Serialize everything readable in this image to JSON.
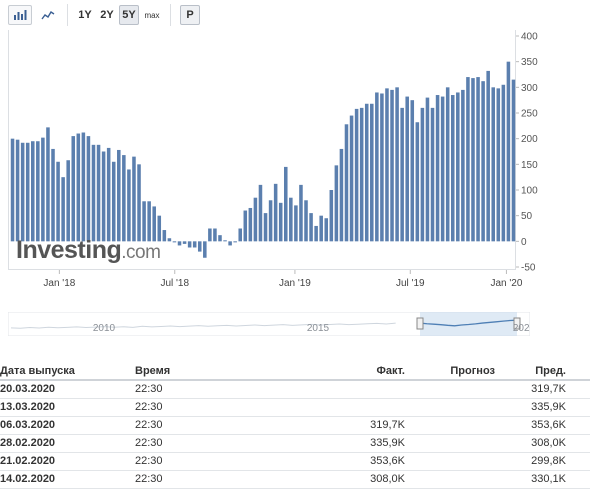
{
  "toolbar": {
    "bar_chart_icon": "bar-chart-icon",
    "line_chart_icon": "line-chart-icon",
    "range_1y": "1Y",
    "range_2y": "2Y",
    "range_5y": "5Y",
    "range_max": "max",
    "print_label": "P",
    "active_range": "5Y"
  },
  "watermark": {
    "brand": "Investing",
    "suffix": ".com"
  },
  "colors": {
    "bar": "#5b7fae",
    "bar_edge": "#4a6d9c",
    "navigator_fill": "#c9dcef",
    "navigator_line": "#4e7fb5"
  },
  "chart_data": {
    "type": "bar",
    "x_ticks": [
      "Jan '18",
      "Jul '18",
      "Jan '19",
      "Jul '19",
      "Jan '20"
    ],
    "y_ticks": [
      400,
      350,
      300,
      250,
      200,
      150,
      100,
      50,
      0,
      -50
    ],
    "ylim": [
      -50,
      400
    ],
    "values": [
      200,
      198,
      192,
      192,
      195,
      195,
      202,
      222,
      180,
      155,
      125,
      158,
      205,
      210,
      212,
      205,
      188,
      188,
      175,
      182,
      155,
      178,
      168,
      140,
      165,
      150,
      78,
      78,
      68,
      50,
      22,
      6,
      -2,
      -8,
      -5,
      -12,
      -12,
      -20,
      -32,
      25,
      25,
      12,
      2,
      -8,
      -2,
      25,
      60,
      65,
      85,
      110,
      55,
      80,
      112,
      75,
      145,
      85,
      70,
      110,
      80,
      55,
      30,
      50,
      45,
      100,
      148,
      180,
      228,
      245,
      258,
      260,
      268,
      268,
      290,
      288,
      298,
      295,
      300,
      260,
      282,
      275,
      232,
      260,
      280,
      260,
      285,
      282,
      300,
      285,
      290,
      295,
      320,
      318,
      320,
      312,
      332,
      300,
      298,
      305,
      350,
      315
    ]
  },
  "navigator": {
    "year_labels": [
      "2010",
      "2015",
      "2020"
    ],
    "series": [
      0.32,
      0.3,
      0.34,
      0.31,
      0.36,
      0.33,
      0.35,
      0.38,
      0.34,
      0.37,
      0.4,
      0.36,
      0.39,
      0.35,
      0.42,
      0.38,
      0.41,
      0.44,
      0.4,
      0.43,
      0.46,
      0.42,
      0.45,
      0.48,
      0.44,
      0.47,
      0.5,
      0.46,
      0.49,
      0.52,
      0.48,
      0.51,
      0.54,
      0.5,
      0.53,
      0.56,
      0.52,
      0.55,
      0.58,
      0.6,
      0.56,
      0.62,
      0.58,
      0.55,
      0.52,
      0.48,
      0.45,
      0.5,
      0.53,
      0.57,
      0.62,
      0.66,
      0.7,
      0.74,
      0.78,
      0.8
    ]
  },
  "table": {
    "headers": {
      "date": "Дата выпуска",
      "time": "Время",
      "actual": "Факт.",
      "forecast": "Прогноз",
      "previous": "Пред."
    },
    "rows": [
      {
        "date": "20.03.2020",
        "time": "22:30",
        "actual": "",
        "forecast": "",
        "previous": "319,7K"
      },
      {
        "date": "13.03.2020",
        "time": "22:30",
        "actual": "",
        "forecast": "",
        "previous": "335,9K"
      },
      {
        "date": "06.03.2020",
        "time": "22:30",
        "actual": "319,7K",
        "forecast": "",
        "previous": "353,6K"
      },
      {
        "date": "28.02.2020",
        "time": "22:30",
        "actual": "335,9K",
        "forecast": "",
        "previous": "308,0K"
      },
      {
        "date": "21.02.2020",
        "time": "22:30",
        "actual": "353,6K",
        "forecast": "",
        "previous": "299,8K"
      },
      {
        "date": "14.02.2020",
        "time": "22:30",
        "actual": "308,0K",
        "forecast": "",
        "previous": "330,1K"
      }
    ]
  }
}
